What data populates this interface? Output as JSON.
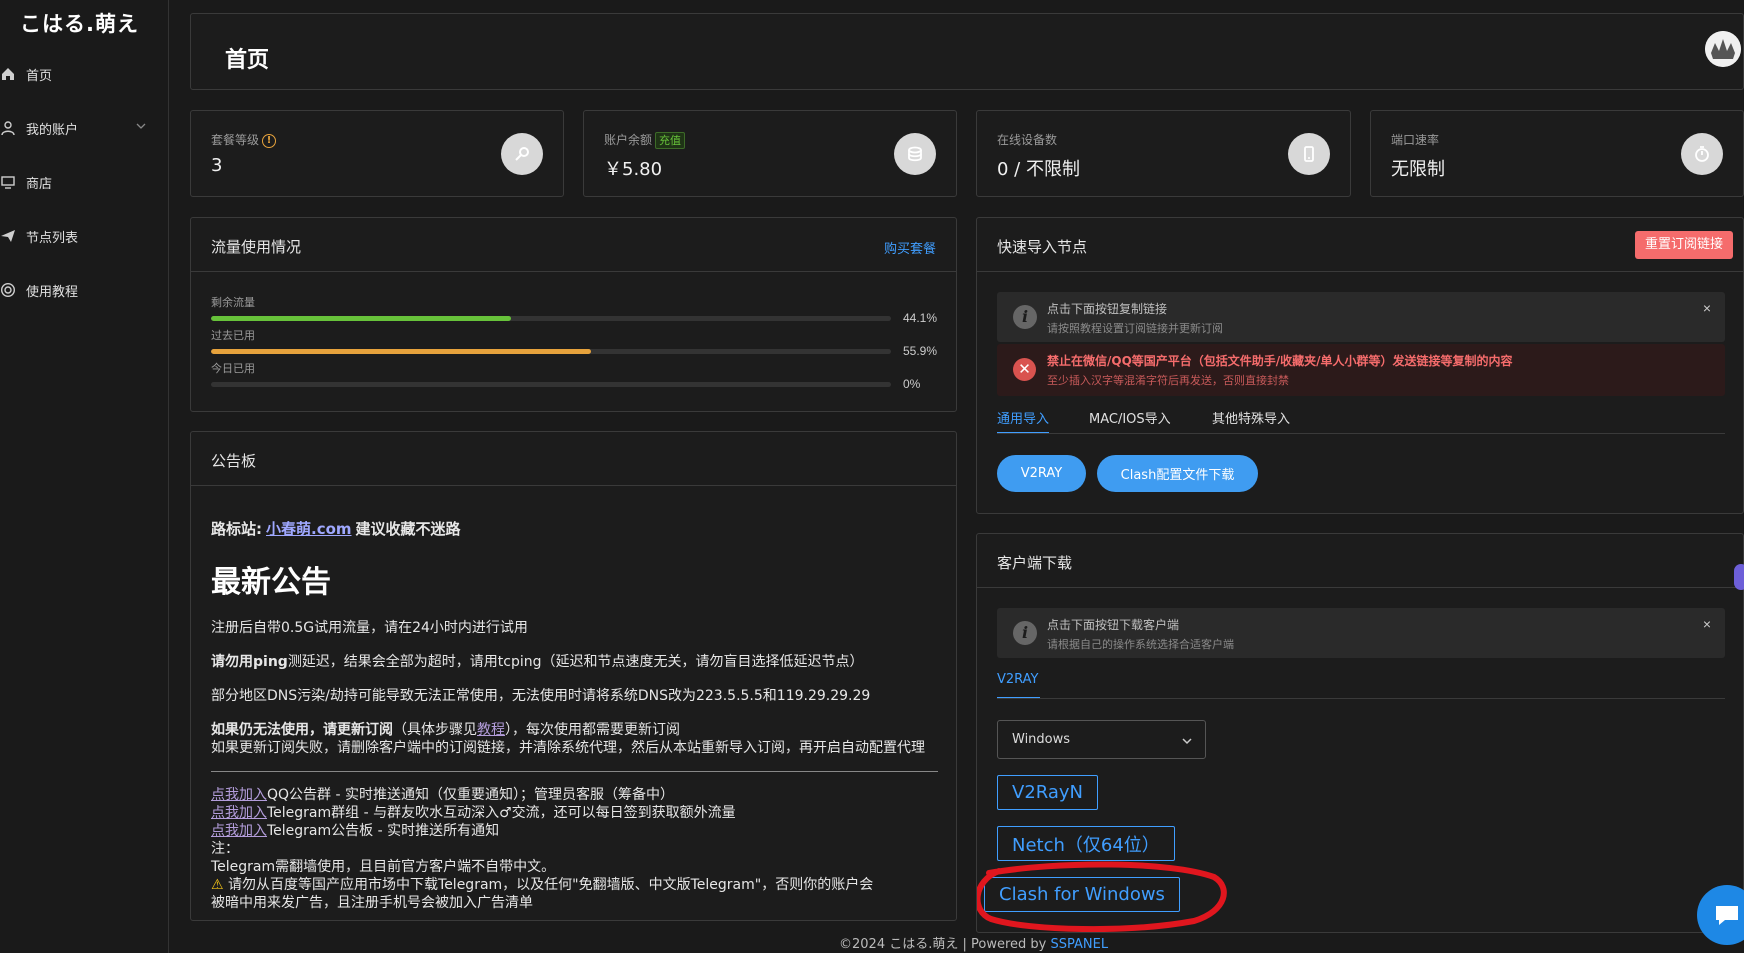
{
  "sidebar": {
    "brand": "こはる.萌え",
    "items": [
      {
        "label": "首页",
        "icon": "home-icon"
      },
      {
        "label": "我的账户",
        "icon": "user-icon"
      },
      {
        "label": "商店",
        "icon": "shop-icon"
      },
      {
        "label": "节点列表",
        "icon": "send-icon"
      },
      {
        "label": "使用教程",
        "icon": "help-icon"
      }
    ]
  },
  "header": {
    "title": "首页"
  },
  "stats": [
    {
      "label": "套餐等级",
      "value": "3",
      "icon": "key-icon"
    },
    {
      "label": "账户余额",
      "badge": "充值",
      "value": "￥5.80",
      "icon": "coins-icon"
    },
    {
      "label": "在线设备数",
      "value": "0 / 不限制",
      "icon": "phone-icon"
    },
    {
      "label": "端口速率",
      "value": "无限制",
      "icon": "stopwatch-icon"
    }
  ],
  "traffic": {
    "title": "流量使用情况",
    "buy_link": "购买套餐",
    "bars": [
      {
        "label": "剩余流量",
        "pct": "44.1%",
        "value": 44.1,
        "color": "#67c23a"
      },
      {
        "label": "过去已用",
        "pct": "55.9%",
        "value": 55.9,
        "color": "#e6a23c"
      },
      {
        "label": "今日已用",
        "pct": "0%",
        "value": 0,
        "color": "#409eff"
      }
    ]
  },
  "notice": {
    "title": "公告板",
    "route_prefix": "路标站:",
    "route_link": "小春萌.com",
    "route_suffix": "建议收藏不迷路",
    "heading": "最新公告",
    "p1": "注册后自带0.5G试用流量，请在24小时内进行试用",
    "p2_bold": "请勿用ping",
    "p2_rest": "测延迟，结果会全部为超时，请用tcping（延迟和节点速度无关，请勿盲目选择低延迟节点）",
    "p3": "部分地区DNS污染/劫持可能导致无法正常使用，无法使用时请将系统DNS改为223.5.5.5和119.29.29.29",
    "p4_bold": "如果仍无法使用，请更新订阅",
    "p4_a": "（具体步骤见",
    "p4_link": "教程",
    "p4_b": "），每次使用都需要更新订阅",
    "p5": "如果更新订阅失败，请删除客户端中的订阅链接，并清除系统代理，然后从本站重新导入订阅，再开启自动配置代理",
    "l1_link": "点我加入",
    "l1_text": "QQ公告群 - 实时推送通知（仅重要通知）；管理员客服（筹备中）",
    "l2_link": "点我加入",
    "l2_text": "Telegram群组 - 与群友吹水互动深入♂交流，还可以每日签到获取额外流量",
    "l3_link": "点我加入",
    "l3_text": "Telegram公告板 - 实时推送所有通知",
    "note": "注：",
    "n1": "Telegram需翻墙使用，且目前官方客户端不自带中文。",
    "n2": "请勿从百度等国产应用市场中下载Telegram，以及任何\"免翻墙版、中文版Telegram\"，否则你的账户会",
    "n3": "被暗中用来发广告，且注册手机号会被加入广告清单"
  },
  "quick_import": {
    "title": "快速导入节点",
    "reset_button": "重置订阅链接",
    "info_title": "点击下面按钮复制链接",
    "info_desc": "请按照教程设置订阅链接并更新订阅",
    "warn_title": "禁止在微信/QQ等国产平台（包括文件助手/收藏夹/单人小群等）发送链接等复制的内容",
    "warn_desc": "至少插入汉字等混淆字符后再发送，否则直接封禁",
    "tabs": [
      "通用导入",
      "MAC/IOS导入",
      "其他特殊导入"
    ],
    "buttons": [
      "V2RAY",
      "Clash配置文件下载"
    ]
  },
  "client_download": {
    "title": "客户端下载",
    "info_title": "点击下面按钮下载客户端",
    "info_desc": "请根据自己的操作系统选择合适客户端",
    "tab": "V2RAY",
    "os_select": "Windows",
    "buttons": [
      "V2RayN",
      "Netch（仅64位）",
      "Clash for Windows"
    ]
  },
  "footer": {
    "text": "©2024 こはる.萌え | Powered by",
    "link": "SSPANEL"
  },
  "colors": {
    "accent": "#409eff",
    "danger": "#f56c6c",
    "annotation": "#e0161e"
  }
}
